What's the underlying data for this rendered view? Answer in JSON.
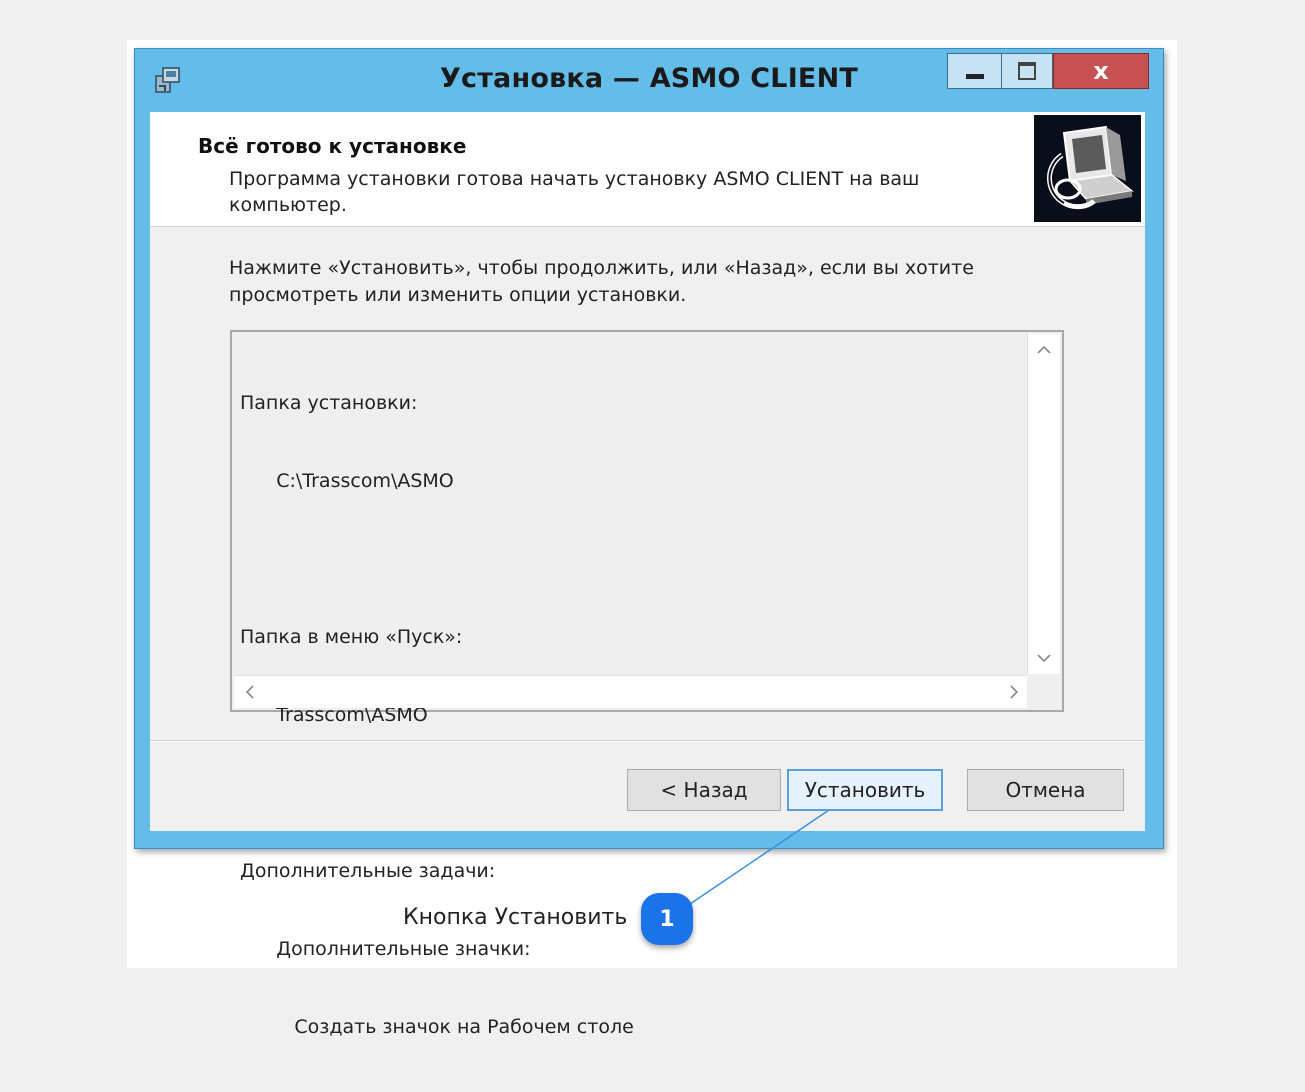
{
  "window": {
    "title": "Установка — ASMO CLIENT",
    "close_glyph": "x"
  },
  "header": {
    "title": "Всё готово к установке",
    "subtitle": "Программа установки готова начать установку ASMO CLIENT на ваш компьютер."
  },
  "instruction": "Нажмите «Установить», чтобы продолжить, или «Назад», если вы хотите просмотреть или изменить опции установки.",
  "memo": {
    "lines": [
      "Папка установки:",
      "      C:\\Trasscom\\ASMO",
      "",
      "Папка в меню «Пуск»:",
      "      Trasscom\\ASMO",
      "",
      "Дополнительные задачи:",
      "      Дополнительные значки:",
      "         Создать значок на Рабочем столе"
    ]
  },
  "buttons": {
    "back": "< Назад",
    "install": "Установить",
    "cancel": "Отмена"
  },
  "annotation": {
    "label": "Кнопка Установить",
    "badge": "1",
    "color": "#1a73e8"
  },
  "colors": {
    "window_frame": "#64bde9",
    "close_button": "#c75050",
    "client_bg": "#f0f0f0"
  }
}
